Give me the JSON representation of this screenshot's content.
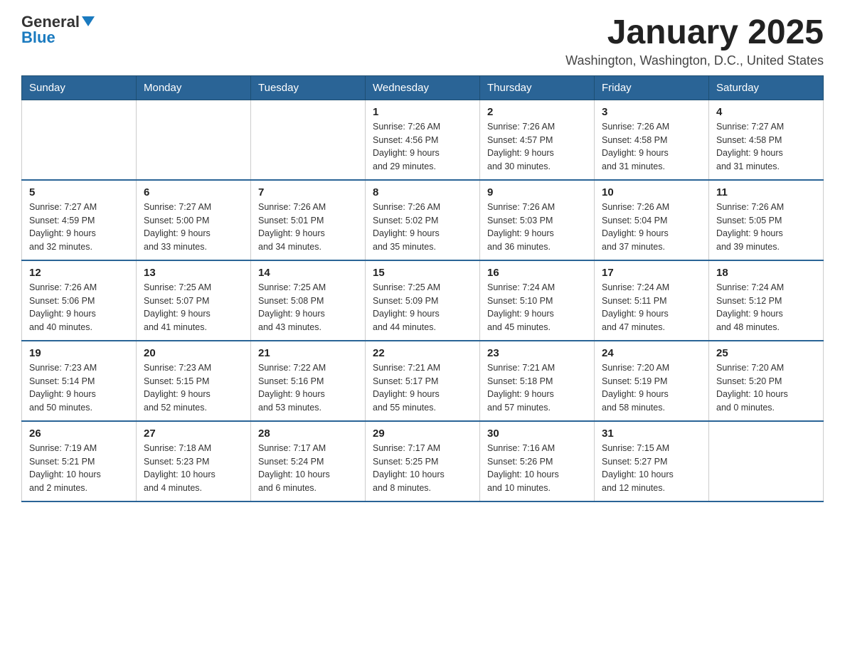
{
  "header": {
    "logo_general": "General",
    "logo_blue": "Blue",
    "month_title": "January 2025",
    "location": "Washington, Washington, D.C., United States"
  },
  "days_of_week": [
    "Sunday",
    "Monday",
    "Tuesday",
    "Wednesday",
    "Thursday",
    "Friday",
    "Saturday"
  ],
  "weeks": [
    [
      {
        "day": "",
        "info": ""
      },
      {
        "day": "",
        "info": ""
      },
      {
        "day": "",
        "info": ""
      },
      {
        "day": "1",
        "info": "Sunrise: 7:26 AM\nSunset: 4:56 PM\nDaylight: 9 hours\nand 29 minutes."
      },
      {
        "day": "2",
        "info": "Sunrise: 7:26 AM\nSunset: 4:57 PM\nDaylight: 9 hours\nand 30 minutes."
      },
      {
        "day": "3",
        "info": "Sunrise: 7:26 AM\nSunset: 4:58 PM\nDaylight: 9 hours\nand 31 minutes."
      },
      {
        "day": "4",
        "info": "Sunrise: 7:27 AM\nSunset: 4:58 PM\nDaylight: 9 hours\nand 31 minutes."
      }
    ],
    [
      {
        "day": "5",
        "info": "Sunrise: 7:27 AM\nSunset: 4:59 PM\nDaylight: 9 hours\nand 32 minutes."
      },
      {
        "day": "6",
        "info": "Sunrise: 7:27 AM\nSunset: 5:00 PM\nDaylight: 9 hours\nand 33 minutes."
      },
      {
        "day": "7",
        "info": "Sunrise: 7:26 AM\nSunset: 5:01 PM\nDaylight: 9 hours\nand 34 minutes."
      },
      {
        "day": "8",
        "info": "Sunrise: 7:26 AM\nSunset: 5:02 PM\nDaylight: 9 hours\nand 35 minutes."
      },
      {
        "day": "9",
        "info": "Sunrise: 7:26 AM\nSunset: 5:03 PM\nDaylight: 9 hours\nand 36 minutes."
      },
      {
        "day": "10",
        "info": "Sunrise: 7:26 AM\nSunset: 5:04 PM\nDaylight: 9 hours\nand 37 minutes."
      },
      {
        "day": "11",
        "info": "Sunrise: 7:26 AM\nSunset: 5:05 PM\nDaylight: 9 hours\nand 39 minutes."
      }
    ],
    [
      {
        "day": "12",
        "info": "Sunrise: 7:26 AM\nSunset: 5:06 PM\nDaylight: 9 hours\nand 40 minutes."
      },
      {
        "day": "13",
        "info": "Sunrise: 7:25 AM\nSunset: 5:07 PM\nDaylight: 9 hours\nand 41 minutes."
      },
      {
        "day": "14",
        "info": "Sunrise: 7:25 AM\nSunset: 5:08 PM\nDaylight: 9 hours\nand 43 minutes."
      },
      {
        "day": "15",
        "info": "Sunrise: 7:25 AM\nSunset: 5:09 PM\nDaylight: 9 hours\nand 44 minutes."
      },
      {
        "day": "16",
        "info": "Sunrise: 7:24 AM\nSunset: 5:10 PM\nDaylight: 9 hours\nand 45 minutes."
      },
      {
        "day": "17",
        "info": "Sunrise: 7:24 AM\nSunset: 5:11 PM\nDaylight: 9 hours\nand 47 minutes."
      },
      {
        "day": "18",
        "info": "Sunrise: 7:24 AM\nSunset: 5:12 PM\nDaylight: 9 hours\nand 48 minutes."
      }
    ],
    [
      {
        "day": "19",
        "info": "Sunrise: 7:23 AM\nSunset: 5:14 PM\nDaylight: 9 hours\nand 50 minutes."
      },
      {
        "day": "20",
        "info": "Sunrise: 7:23 AM\nSunset: 5:15 PM\nDaylight: 9 hours\nand 52 minutes."
      },
      {
        "day": "21",
        "info": "Sunrise: 7:22 AM\nSunset: 5:16 PM\nDaylight: 9 hours\nand 53 minutes."
      },
      {
        "day": "22",
        "info": "Sunrise: 7:21 AM\nSunset: 5:17 PM\nDaylight: 9 hours\nand 55 minutes."
      },
      {
        "day": "23",
        "info": "Sunrise: 7:21 AM\nSunset: 5:18 PM\nDaylight: 9 hours\nand 57 minutes."
      },
      {
        "day": "24",
        "info": "Sunrise: 7:20 AM\nSunset: 5:19 PM\nDaylight: 9 hours\nand 58 minutes."
      },
      {
        "day": "25",
        "info": "Sunrise: 7:20 AM\nSunset: 5:20 PM\nDaylight: 10 hours\nand 0 minutes."
      }
    ],
    [
      {
        "day": "26",
        "info": "Sunrise: 7:19 AM\nSunset: 5:21 PM\nDaylight: 10 hours\nand 2 minutes."
      },
      {
        "day": "27",
        "info": "Sunrise: 7:18 AM\nSunset: 5:23 PM\nDaylight: 10 hours\nand 4 minutes."
      },
      {
        "day": "28",
        "info": "Sunrise: 7:17 AM\nSunset: 5:24 PM\nDaylight: 10 hours\nand 6 minutes."
      },
      {
        "day": "29",
        "info": "Sunrise: 7:17 AM\nSunset: 5:25 PM\nDaylight: 10 hours\nand 8 minutes."
      },
      {
        "day": "30",
        "info": "Sunrise: 7:16 AM\nSunset: 5:26 PM\nDaylight: 10 hours\nand 10 minutes."
      },
      {
        "day": "31",
        "info": "Sunrise: 7:15 AM\nSunset: 5:27 PM\nDaylight: 10 hours\nand 12 minutes."
      },
      {
        "day": "",
        "info": ""
      }
    ]
  ]
}
